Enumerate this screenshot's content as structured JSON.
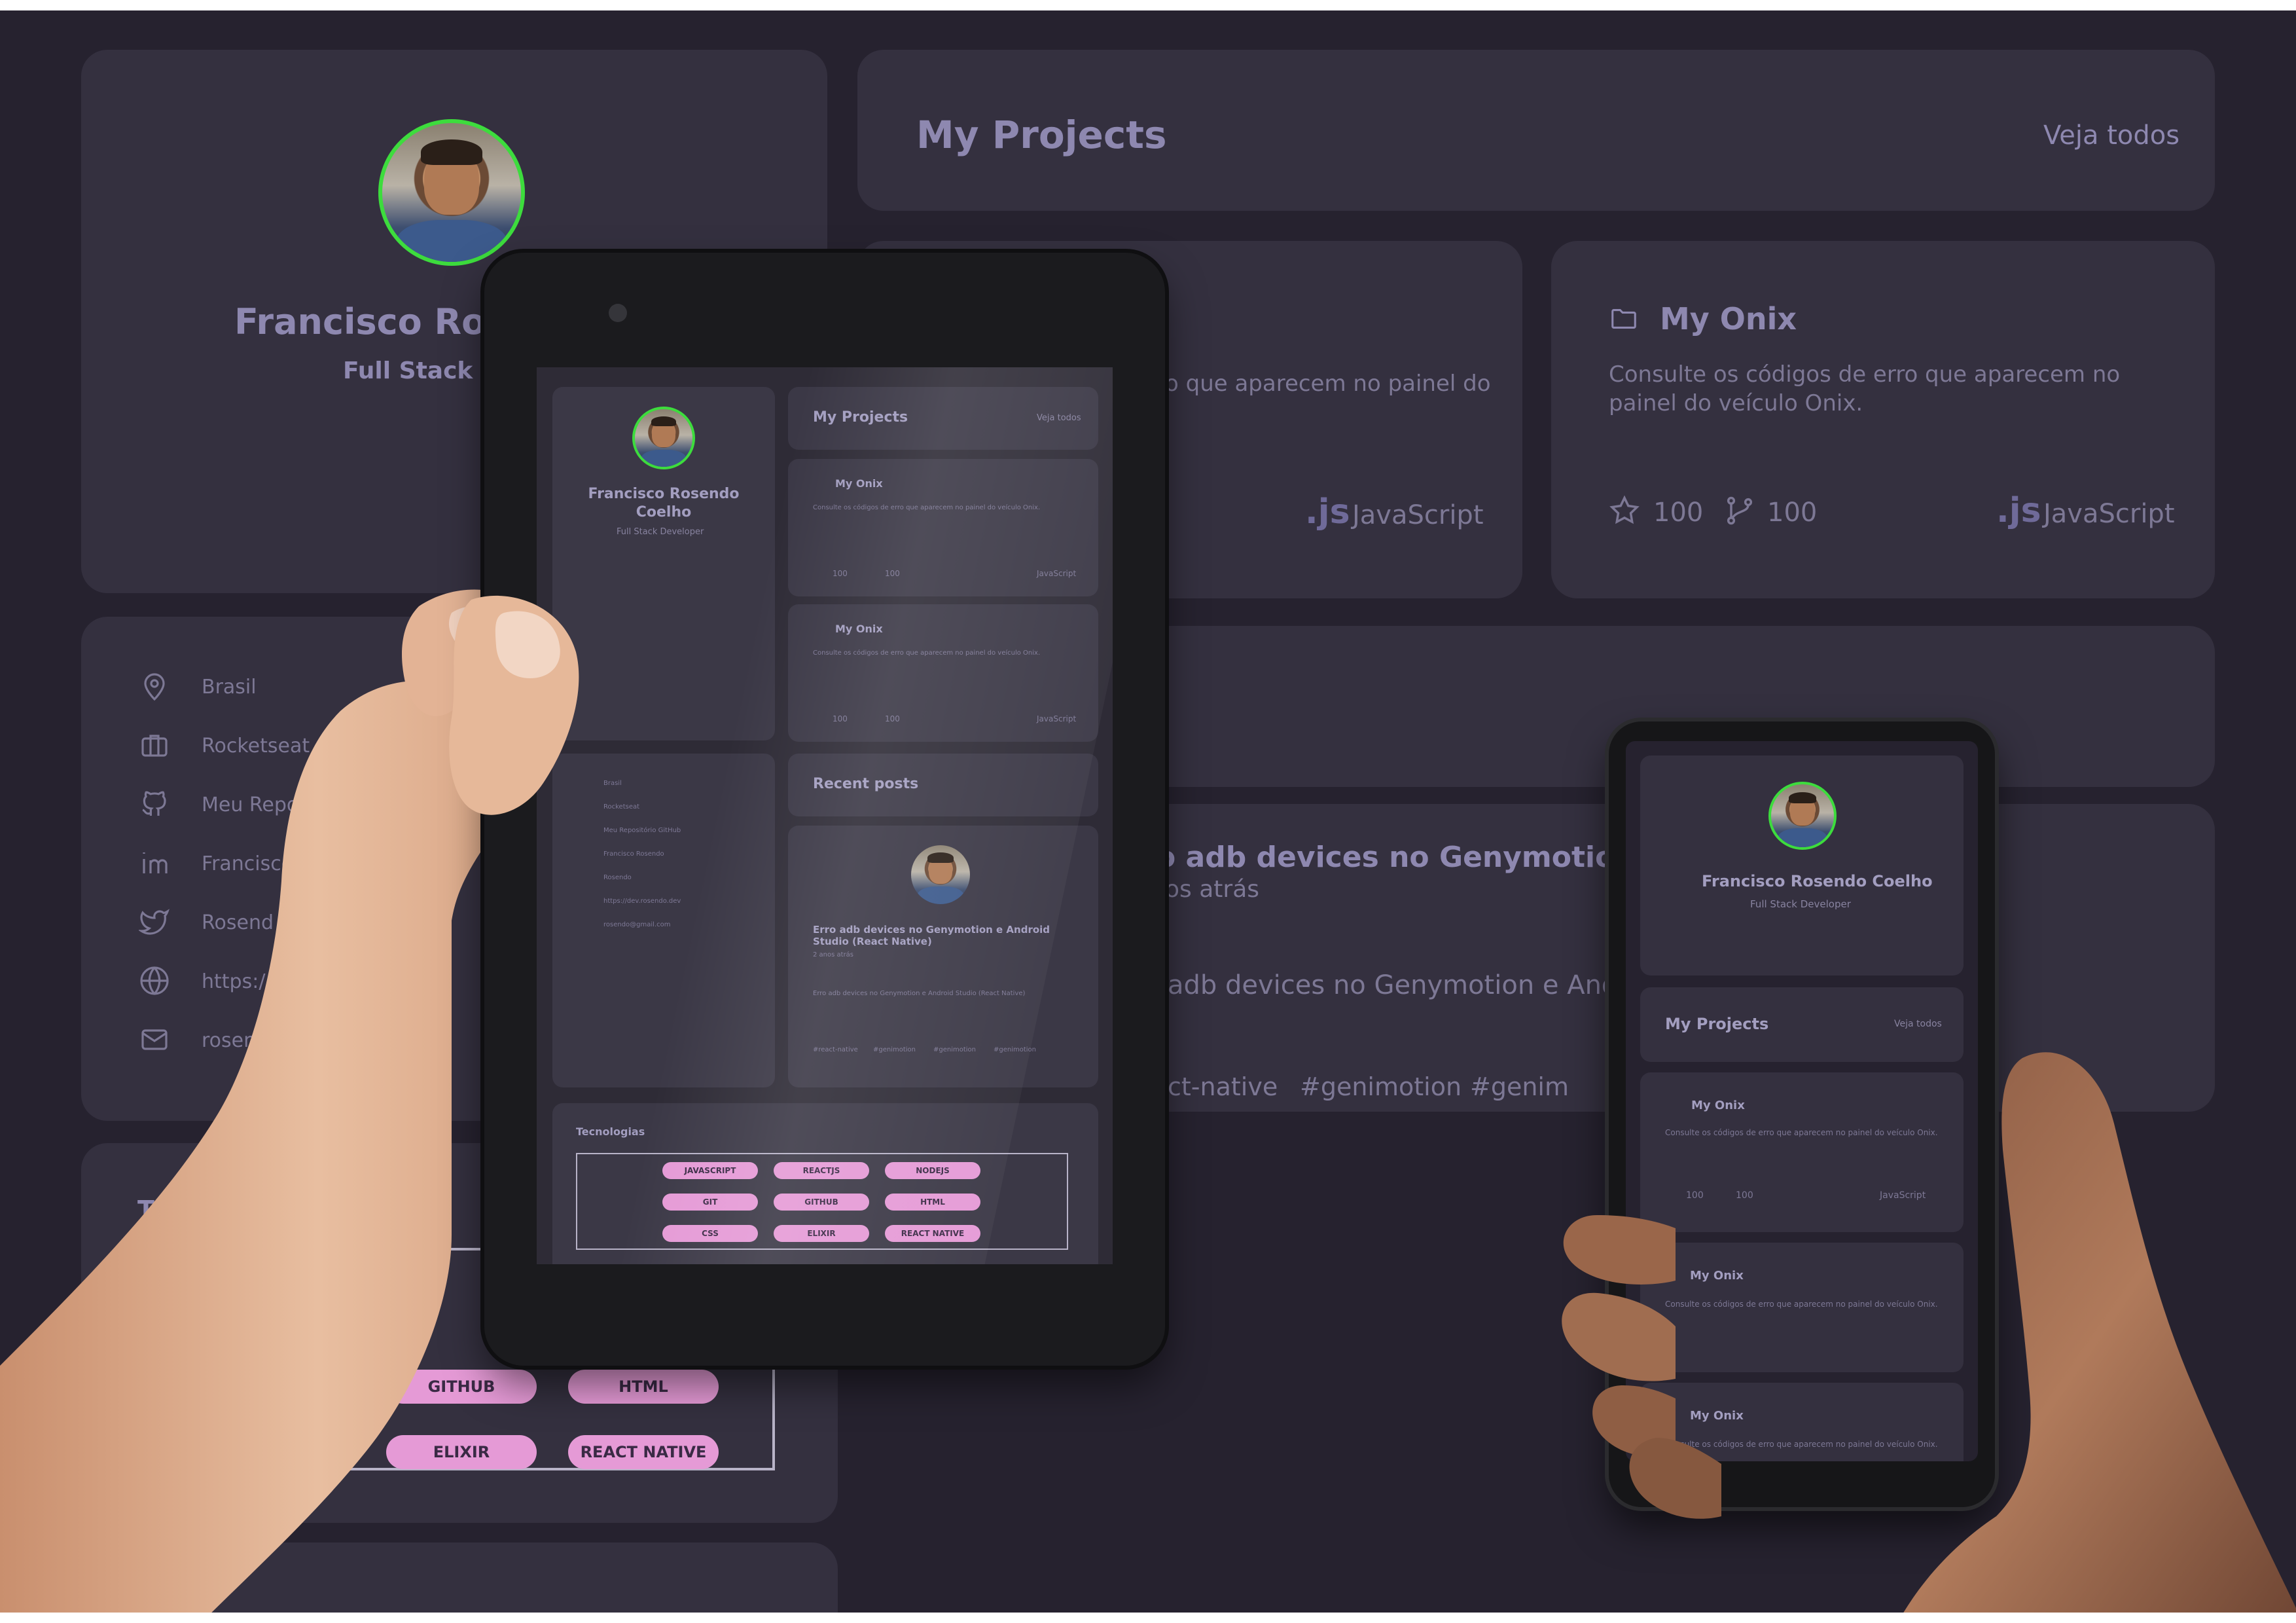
{
  "profile": {
    "name_partial": "Francisco Rose",
    "role_partial": "Full Stack De",
    "name": "Francisco Rosendo Coelho",
    "name_line1": "Francisco Rosendo",
    "name_line2": "Coelho",
    "role": "Full Stack Developer"
  },
  "sidebar": {
    "items_partial": [
      "Brasil",
      "Rocketseat",
      "Meu Repo",
      "Francisco",
      "Rosend",
      "https:/",
      "rosend"
    ],
    "items_tablet": [
      "Brasil",
      "Rocketseat",
      "Meu Repositório GitHub",
      "Francisco Rosendo",
      "Rosendo",
      "https://dev.rosendo.dev",
      "rosendo@gmail.com"
    ]
  },
  "projects": {
    "title": "My Projects",
    "see_all": "Veja todos",
    "card_title": "My Onix",
    "description": "Consulte os códigos de erro que aparecem no painel do veículo Onix.",
    "description_partial": "o que aparecem no painel do",
    "stars": "100",
    "forks": "100",
    "js_badge": ".js",
    "language": "JavaScript"
  },
  "posts": {
    "title": "Recent posts",
    "post_title_partial": "o adb devices no Genymotion e An",
    "post_time_partial": "os atrás",
    "post_body_partial": "adb devices no Genymotion e Android St",
    "tags_partial": [
      "ct-native",
      "#genimotion",
      "#genim"
    ],
    "post_title": "Erro adb devices no Genymotion e Android Studio (React Native)",
    "post_time": "2 anos atrás",
    "post_body": "Erro adb devices no Genymotion e Android Studio (React Native)",
    "tags": [
      "#react-native",
      "#genimotion",
      "#genimotion",
      "#genimotion"
    ]
  },
  "tech": {
    "title": "Tecnologias",
    "items": [
      "JAVASCRIPT",
      "REACTJS",
      "NODEJS",
      "GIT",
      "GITHUB",
      "HTML",
      "CSS",
      "ELIXIR",
      "REACT NATIVE"
    ]
  },
  "colors": {
    "background": "#26222f",
    "card": "#34303f",
    "text": "#8e88b0",
    "pill": "#e59ad6",
    "avatar_ring": "#3ddc3d"
  }
}
